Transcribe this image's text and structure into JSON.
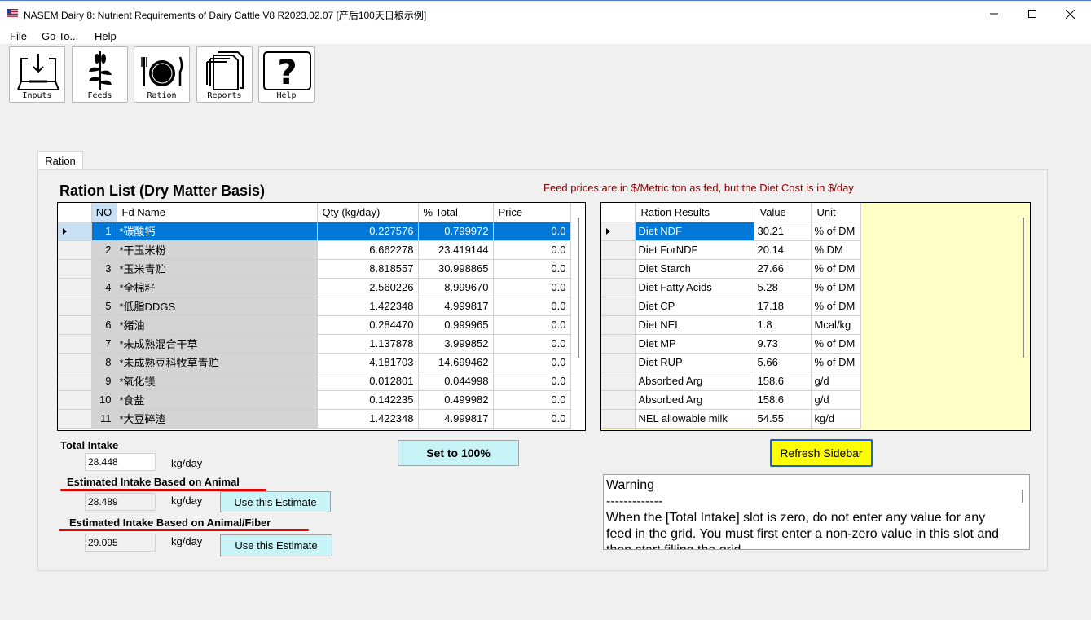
{
  "window": {
    "title": "NASEM Dairy 8: Nutrient Requirements of Dairy Cattle  V8 R2023.02.07 [产后100天日粮示例]"
  },
  "menu": [
    "File",
    "Go To...",
    "Help"
  ],
  "toolbar": {
    "inputs": "Inputs",
    "feeds": "Feeds",
    "ration": "Ration",
    "reports": "Reports",
    "help": "Help"
  },
  "tab": "Ration",
  "ration_list": {
    "title": "Ration List (Dry Matter Basis)",
    "price_note": "Feed prices are in $/Metric ton as fed, but the Diet Cost is in $/day",
    "columns": [
      "NO",
      "Fd  Name",
      "Qty (kg/day)",
      "% Total",
      "Price"
    ],
    "selected_row": 0,
    "rows": [
      {
        "no": "1",
        "name": "*碳酸钙",
        "qty": "0.227576",
        "pct": "0.799972",
        "price": "0.0"
      },
      {
        "no": "2",
        "name": "*干玉米粉",
        "qty": "6.662278",
        "pct": "23.419144",
        "price": "0.0"
      },
      {
        "no": "3",
        "name": "*玉米青贮",
        "qty": "8.818557",
        "pct": "30.998865",
        "price": "0.0"
      },
      {
        "no": "4",
        "name": "*全棉籽",
        "qty": "2.560226",
        "pct": "8.999670",
        "price": "0.0"
      },
      {
        "no": "5",
        "name": "*低脂DDGS",
        "qty": "1.422348",
        "pct": "4.999817",
        "price": "0.0"
      },
      {
        "no": "6",
        "name": "*猪油",
        "qty": "0.284470",
        "pct": "0.999965",
        "price": "0.0"
      },
      {
        "no": "7",
        "name": "*未成熟混合干草",
        "qty": "1.137878",
        "pct": "3.999852",
        "price": "0.0"
      },
      {
        "no": "8",
        "name": "*未成熟豆科牧草青贮",
        "qty": "4.181703",
        "pct": "14.699462",
        "price": "0.0"
      },
      {
        "no": "9",
        "name": "*氧化镁",
        "qty": "0.012801",
        "pct": "0.044998",
        "price": "0.0"
      },
      {
        "no": "10",
        "name": "*食盐",
        "qty": "0.142235",
        "pct": "0.499982",
        "price": "0.0"
      },
      {
        "no": "11",
        "name": "*大豆碎渣",
        "qty": "1.422348",
        "pct": "4.999817",
        "price": "0.0"
      }
    ]
  },
  "results": {
    "columns": [
      "Ration Results",
      "Value",
      "Unit"
    ],
    "selected_row": 0,
    "rows": [
      {
        "label": "Diet NDF",
        "value": "30.21",
        "unit": "% of DM"
      },
      {
        "label": "Diet ForNDF",
        "value": "20.14",
        "unit": "% DM"
      },
      {
        "label": "Diet Starch",
        "value": "27.66",
        "unit": "% of DM"
      },
      {
        "label": "Diet Fatty Acids",
        "value": "5.28",
        "unit": "% of DM"
      },
      {
        "label": "Diet CP",
        "value": "17.18",
        "unit": "% of DM"
      },
      {
        "label": "Diet NEL",
        "value": "1.8",
        "unit": "Mcal/kg"
      },
      {
        "label": "Diet MP",
        "value": "9.73",
        "unit": "% of DM"
      },
      {
        "label": "Diet RUP",
        "value": "5.66",
        "unit": "% of DM"
      },
      {
        "label": "Absorbed Arg",
        "value": "158.6",
        "unit": "g/d"
      },
      {
        "label": "Absorbed Arg",
        "value": "158.6",
        "unit": "g/d"
      },
      {
        "label": "NEL allowable milk",
        "value": "54.55",
        "unit": "kg/d"
      }
    ]
  },
  "intake": {
    "total_label": "Total Intake",
    "total_value": "28.448",
    "unit": "kg/day",
    "animal_label": "Estimated Intake Based on Animal",
    "animal_value": "28.489",
    "fiber_label": "Estimated Intake Based on Animal/Fiber",
    "fiber_value": "29.095",
    "use_estimate": "Use this Estimate"
  },
  "buttons": {
    "set100": "Set to 100%",
    "refresh": "Refresh Sidebar"
  },
  "warning": {
    "title": "Warning",
    "divider": "-------------",
    "body": "When the [Total Intake] slot is zero, do not enter any value for any feed in the grid. You must first enter a non-zero value in this slot and then start filling the grid."
  },
  "colors": {
    "selection": "#0078d7",
    "results_bg": "#ffffc8",
    "cyan_button": "#c8f4f8",
    "refresh_button": "#ffff00",
    "price_note": "#8b0000",
    "annotation_red": "#e00000"
  }
}
